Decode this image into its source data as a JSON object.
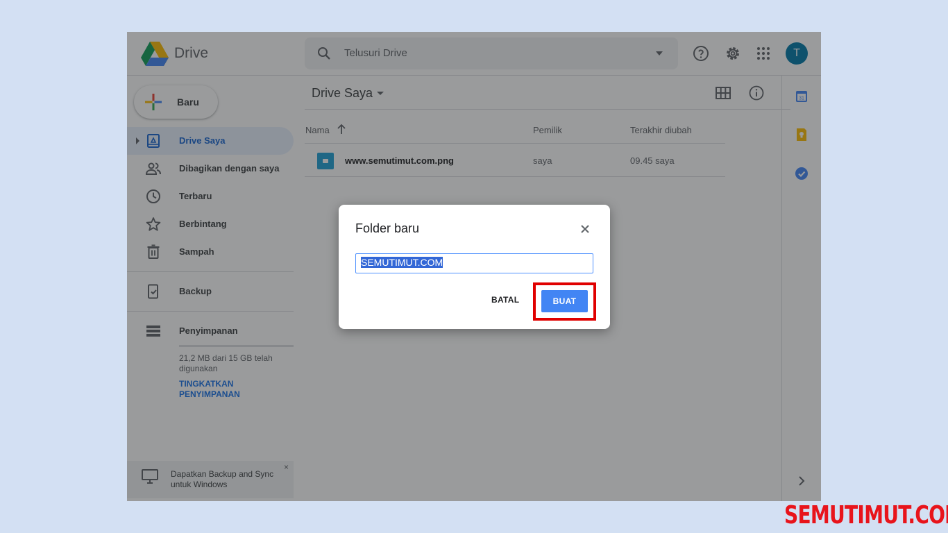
{
  "app": {
    "name": "Drive"
  },
  "search": {
    "placeholder": "Telusuri Drive"
  },
  "user": {
    "avatar_initial": "T"
  },
  "new_button": {
    "label": "Baru"
  },
  "sidebar": {
    "items": [
      {
        "label": "Drive Saya",
        "icon": "my-drive-icon",
        "active": true
      },
      {
        "label": "Dibagikan dengan saya",
        "icon": "shared-icon"
      },
      {
        "label": "Terbaru",
        "icon": "clock-icon"
      },
      {
        "label": "Berbintang",
        "icon": "star-icon"
      },
      {
        "label": "Sampah",
        "icon": "trash-icon"
      },
      {
        "label": "Backup",
        "icon": "backup-icon"
      },
      {
        "label": "Penyimpanan",
        "icon": "storage-icon"
      }
    ],
    "storage_text": "21,2 MB dari 15 GB telah digunakan",
    "upgrade_label": "TINGKATKAN PENYIMPANAN",
    "promo_text": "Dapatkan Backup and Sync untuk Windows",
    "promo_close": "×"
  },
  "main": {
    "title": "Drive Saya",
    "columns": {
      "name": "Nama",
      "owner": "Pemilik",
      "modified": "Terakhir diubah"
    },
    "files": [
      {
        "name": "www.semutimut.com.png",
        "owner": "saya",
        "modified": "09.45 saya"
      }
    ]
  },
  "dialog": {
    "title": "Folder baru",
    "input_value": "SEMUTIMUT.COM",
    "cancel_label": "BATAL",
    "create_label": "BUAT"
  },
  "watermark": "SEMUTIMUT.COM",
  "colors": {
    "accent": "#4285f4",
    "active_nav": "#1967d2",
    "highlight": "#e00000",
    "watermark": "#e8141b"
  }
}
